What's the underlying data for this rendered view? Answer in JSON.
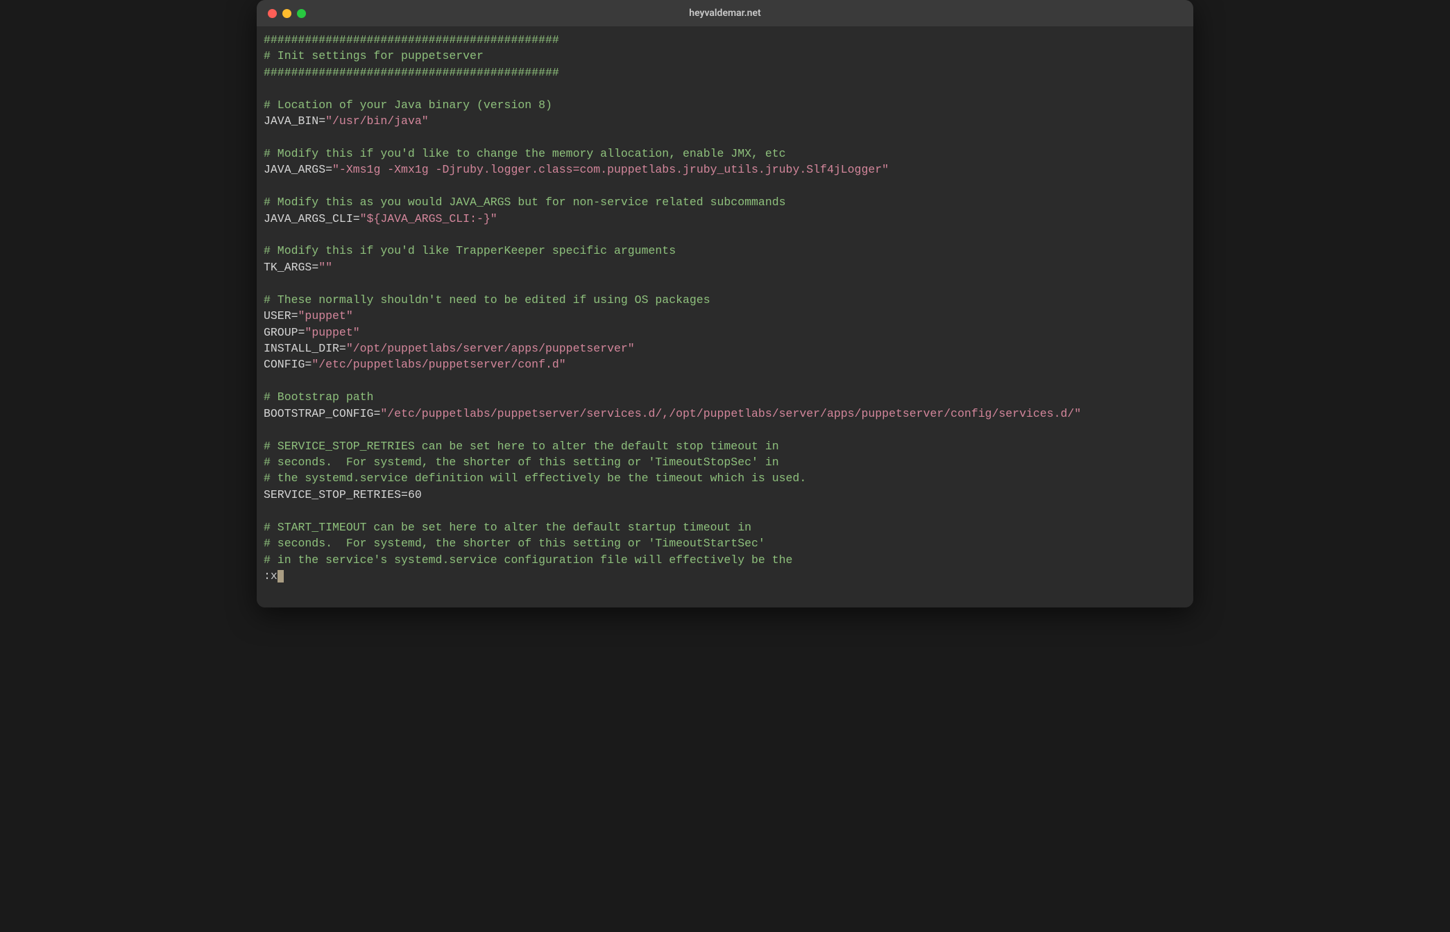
{
  "window": {
    "title": "heyvaldemar.net"
  },
  "file": {
    "lines": [
      {
        "type": "comment",
        "text": "###########################################"
      },
      {
        "type": "comment",
        "text": "# Init settings for puppetserver"
      },
      {
        "type": "comment",
        "text": "###########################################"
      },
      {
        "type": "blank"
      },
      {
        "type": "comment",
        "text": "# Location of your Java binary (version 8)"
      },
      {
        "type": "assign",
        "name": "JAVA_BIN",
        "value": "\"/usr/bin/java\""
      },
      {
        "type": "blank"
      },
      {
        "type": "comment",
        "text": "# Modify this if you'd like to change the memory allocation, enable JMX, etc"
      },
      {
        "type": "assign",
        "name": "JAVA_ARGS",
        "value": "\"-Xms1g -Xmx1g -Djruby.logger.class=com.puppetlabs.jruby_utils.jruby.Slf4jLogger\""
      },
      {
        "type": "blank"
      },
      {
        "type": "comment",
        "text": "# Modify this as you would JAVA_ARGS but for non-service related subcommands"
      },
      {
        "type": "assign",
        "name": "JAVA_ARGS_CLI",
        "value": "\"${JAVA_ARGS_CLI:-}\""
      },
      {
        "type": "blank"
      },
      {
        "type": "comment",
        "text": "# Modify this if you'd like TrapperKeeper specific arguments"
      },
      {
        "type": "assign",
        "name": "TK_ARGS",
        "value": "\"\""
      },
      {
        "type": "blank"
      },
      {
        "type": "comment",
        "text": "# These normally shouldn't need to be edited if using OS packages"
      },
      {
        "type": "assign",
        "name": "USER",
        "value": "\"puppet\""
      },
      {
        "type": "assign",
        "name": "GROUP",
        "value": "\"puppet\""
      },
      {
        "type": "assign",
        "name": "INSTALL_DIR",
        "value": "\"/opt/puppetlabs/server/apps/puppetserver\""
      },
      {
        "type": "assign",
        "name": "CONFIG",
        "value": "\"/etc/puppetlabs/puppetserver/conf.d\""
      },
      {
        "type": "blank"
      },
      {
        "type": "comment",
        "text": "# Bootstrap path"
      },
      {
        "type": "assign",
        "name": "BOOTSTRAP_CONFIG",
        "value": "\"/etc/puppetlabs/puppetserver/services.d/,/opt/puppetlabs/server/apps/puppetserver/config/services.d/\""
      },
      {
        "type": "blank"
      },
      {
        "type": "comment",
        "text": "# SERVICE_STOP_RETRIES can be set here to alter the default stop timeout in"
      },
      {
        "type": "comment",
        "text": "# seconds.  For systemd, the shorter of this setting or 'TimeoutStopSec' in"
      },
      {
        "type": "comment",
        "text": "# the systemd.service definition will effectively be the timeout which is used."
      },
      {
        "type": "assign_plain",
        "name": "SERVICE_STOP_RETRIES",
        "value": "60"
      },
      {
        "type": "blank"
      },
      {
        "type": "comment",
        "text": "# START_TIMEOUT can be set here to alter the default startup timeout in"
      },
      {
        "type": "comment",
        "text": "# seconds.  For systemd, the shorter of this setting or 'TimeoutStartSec'"
      },
      {
        "type": "comment",
        "text": "# in the service's systemd.service configuration file will effectively be the"
      }
    ],
    "command_line": ":x"
  }
}
